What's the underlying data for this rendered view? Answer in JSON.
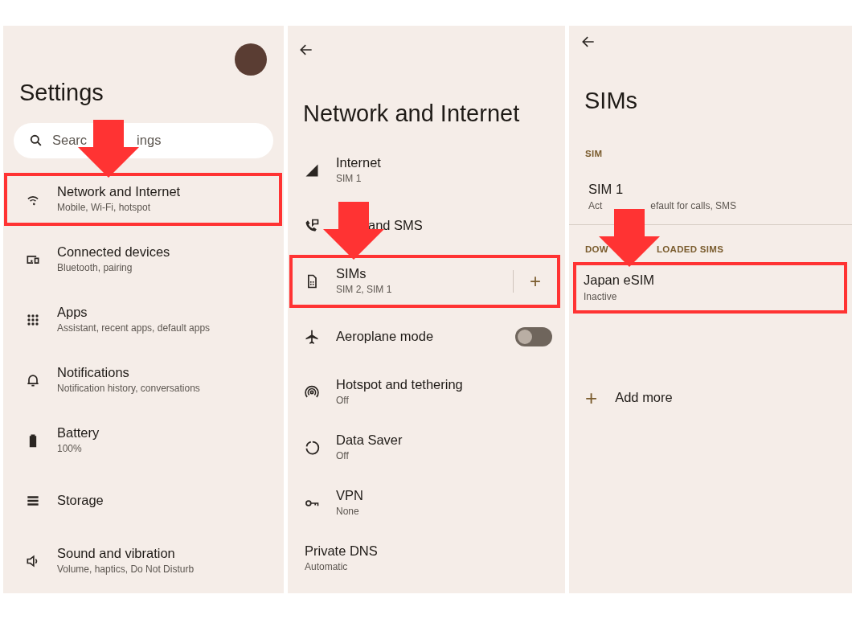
{
  "panels": [
    {
      "kind": "home",
      "title": "Settings",
      "search": {
        "text_parts": [
          "Searc",
          "ings"
        ]
      },
      "items": [
        {
          "title": "Network and Internet",
          "subtitle": "Mobile, Wi-Fi, hotspot",
          "highlighted": true
        },
        {
          "title": "Connected devices",
          "subtitle": "Bluetooth, pairing",
          "highlighted": false
        },
        {
          "title": "Apps",
          "subtitle": "Assistant, recent apps, default apps",
          "highlighted": false
        },
        {
          "title": "Notifications",
          "subtitle": "Notification history, conversations",
          "highlighted": false
        },
        {
          "title": "Battery",
          "subtitle": "100%",
          "highlighted": false
        },
        {
          "title": "Storage",
          "highlighted": false
        },
        {
          "title": "Sound and vibration",
          "subtitle": "Volume, haptics, Do Not Disturb",
          "highlighted": false
        }
      ]
    },
    {
      "kind": "detail",
      "title": "Network and Internet",
      "items": [
        {
          "kind": "link",
          "title": "Internet",
          "subtitle": "SIM 1",
          "highlighted": false
        },
        {
          "kind": "link",
          "title": "and SMS",
          "title_covered": true,
          "highlighted": false
        },
        {
          "kind": "add",
          "title": "SIMs",
          "subtitle": "SIM 2, SIM 1",
          "add_label": "+",
          "highlighted": true
        },
        {
          "kind": "toggle",
          "title": "Aeroplane mode",
          "on": false,
          "highlighted": false
        },
        {
          "kind": "link",
          "title": "Hotspot and tethering",
          "subtitle": "Off",
          "highlighted": false
        },
        {
          "kind": "link",
          "title": "Data Saver",
          "subtitle": "Off",
          "highlighted": false
        },
        {
          "kind": "link",
          "title": "VPN",
          "subtitle": "None",
          "highlighted": false
        },
        {
          "kind": "plain",
          "title": "Private DNS",
          "subtitle": "Automatic",
          "highlighted": false
        }
      ]
    },
    {
      "kind": "sims",
      "title": "SIMs",
      "sections": [
        {
          "header_parts": [
            "SIM"
          ],
          "items": [
            {
              "title": "SIM 1",
              "subtitle_parts": [
                "Act",
                "efault for calls, SMS"
              ],
              "highlighted": false
            }
          ]
        },
        {
          "header_parts": [
            "DOW",
            "LOADED SIMS"
          ],
          "items": [
            {
              "title": "Japan  eSIM",
              "subtitle_parts": [
                "Inactive"
              ],
              "highlighted": true
            }
          ]
        }
      ],
      "add_more": {
        "icon": "+",
        "label": "Add more"
      }
    }
  ]
}
